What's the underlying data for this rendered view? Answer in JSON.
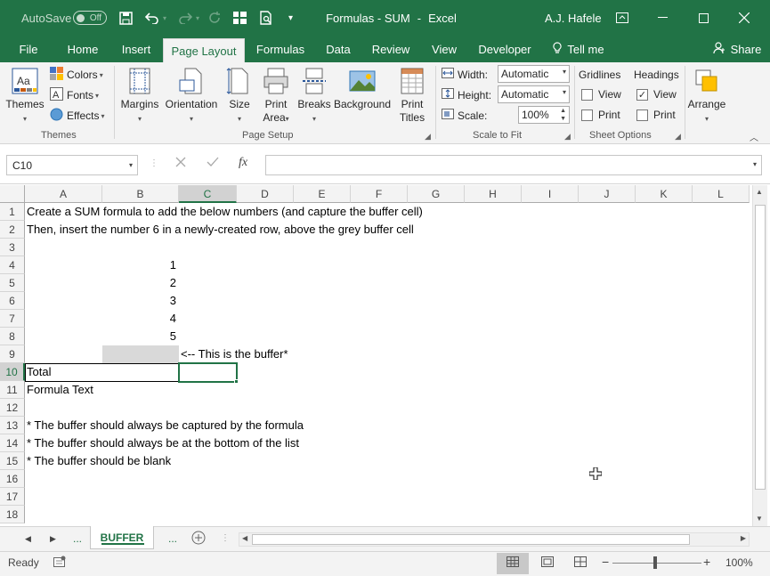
{
  "titlebar": {
    "autosave_label": "AutoSave",
    "autosave_state": "Off",
    "title": "Formulas - SUM",
    "app": "Excel",
    "user": "A.J. Hafele",
    "save_icon": "save-icon",
    "undo_icon": "undo-icon",
    "redo_icon": "redo-icon",
    "brand_color": "#217346"
  },
  "tabs": [
    {
      "label": "File"
    },
    {
      "label": "Home"
    },
    {
      "label": "Insert"
    },
    {
      "label": "Page Layout"
    },
    {
      "label": "Formulas"
    },
    {
      "label": "Data"
    },
    {
      "label": "Review"
    },
    {
      "label": "View"
    },
    {
      "label": "Developer"
    },
    {
      "label": "Tell me"
    },
    {
      "label": "Share"
    }
  ],
  "ribbon": {
    "themes": {
      "themes_label": "Themes",
      "colors_label": "Colors",
      "fonts_label": "Fonts",
      "effects_label": "Effects",
      "group_label": "Themes"
    },
    "page_setup": {
      "margins": "Margins",
      "orientation": "Orientation",
      "size": "Size",
      "print_area_1": "Print",
      "print_area_2": "Area",
      "breaks": "Breaks",
      "background": "Background",
      "print_titles_1": "Print",
      "print_titles_2": "Titles",
      "group_label": "Page Setup"
    },
    "scale_to_fit": {
      "width_label": "Width:",
      "width_value": "Automatic",
      "height_label": "Height:",
      "height_value": "Automatic",
      "scale_label": "Scale:",
      "scale_value": "100%",
      "group_label": "Scale to Fit"
    },
    "sheet_options": {
      "gridlines": "Gridlines",
      "headings": "Headings",
      "gridlines_view": "View",
      "gridlines_print": "Print",
      "headings_view": "View",
      "headings_print": "Print",
      "gridlines_view_checked": false,
      "gridlines_print_checked": false,
      "headings_view_checked": true,
      "headings_print_checked": false,
      "group_label": "Sheet Options"
    },
    "arrange": {
      "label": "Arrange"
    }
  },
  "formula_bar": {
    "name_box": "C10",
    "fx": "fx",
    "content": ""
  },
  "columns": [
    "A",
    "B",
    "C",
    "D",
    "E",
    "F",
    "G",
    "H",
    "I",
    "J",
    "K",
    "L"
  ],
  "selected_column": "C",
  "rows": [
    "1",
    "2",
    "3",
    "4",
    "5",
    "6",
    "7",
    "8",
    "9",
    "10",
    "11",
    "12",
    "13",
    "14",
    "15",
    "16",
    "17",
    "18"
  ],
  "selected_row": "10",
  "cells": {
    "A1": "Create a SUM formula to add the below numbers (and capture the buffer cell)",
    "A2": "Then, insert the number 6 in a newly-created row, above the grey buffer cell",
    "B4": "1",
    "B5": "2",
    "B6": "3",
    "B7": "4",
    "B8": "5",
    "C9": "<-- This is the buffer*",
    "A10": "Total",
    "A11": "Formula Text",
    "A13": "* The buffer should always be captured by the formula",
    "A14": "* The buffer should always be at the bottom of the list",
    "A15": "* The buffer should be blank"
  },
  "buffer_fill_color": "#d9d9d9",
  "sheet_tabs": {
    "active": "BUFFER",
    "more_left": "...",
    "more_right": "..."
  },
  "status": {
    "ready": "Ready",
    "zoom": "100%"
  }
}
